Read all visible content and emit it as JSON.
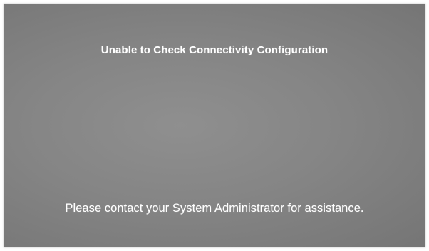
{
  "screen": {
    "title": "Unable to Check Connectivity Configuration",
    "message": "Please contact your System Administrator for assistance.",
    "background_color": "#868686",
    "text_color": "#ffffff"
  }
}
